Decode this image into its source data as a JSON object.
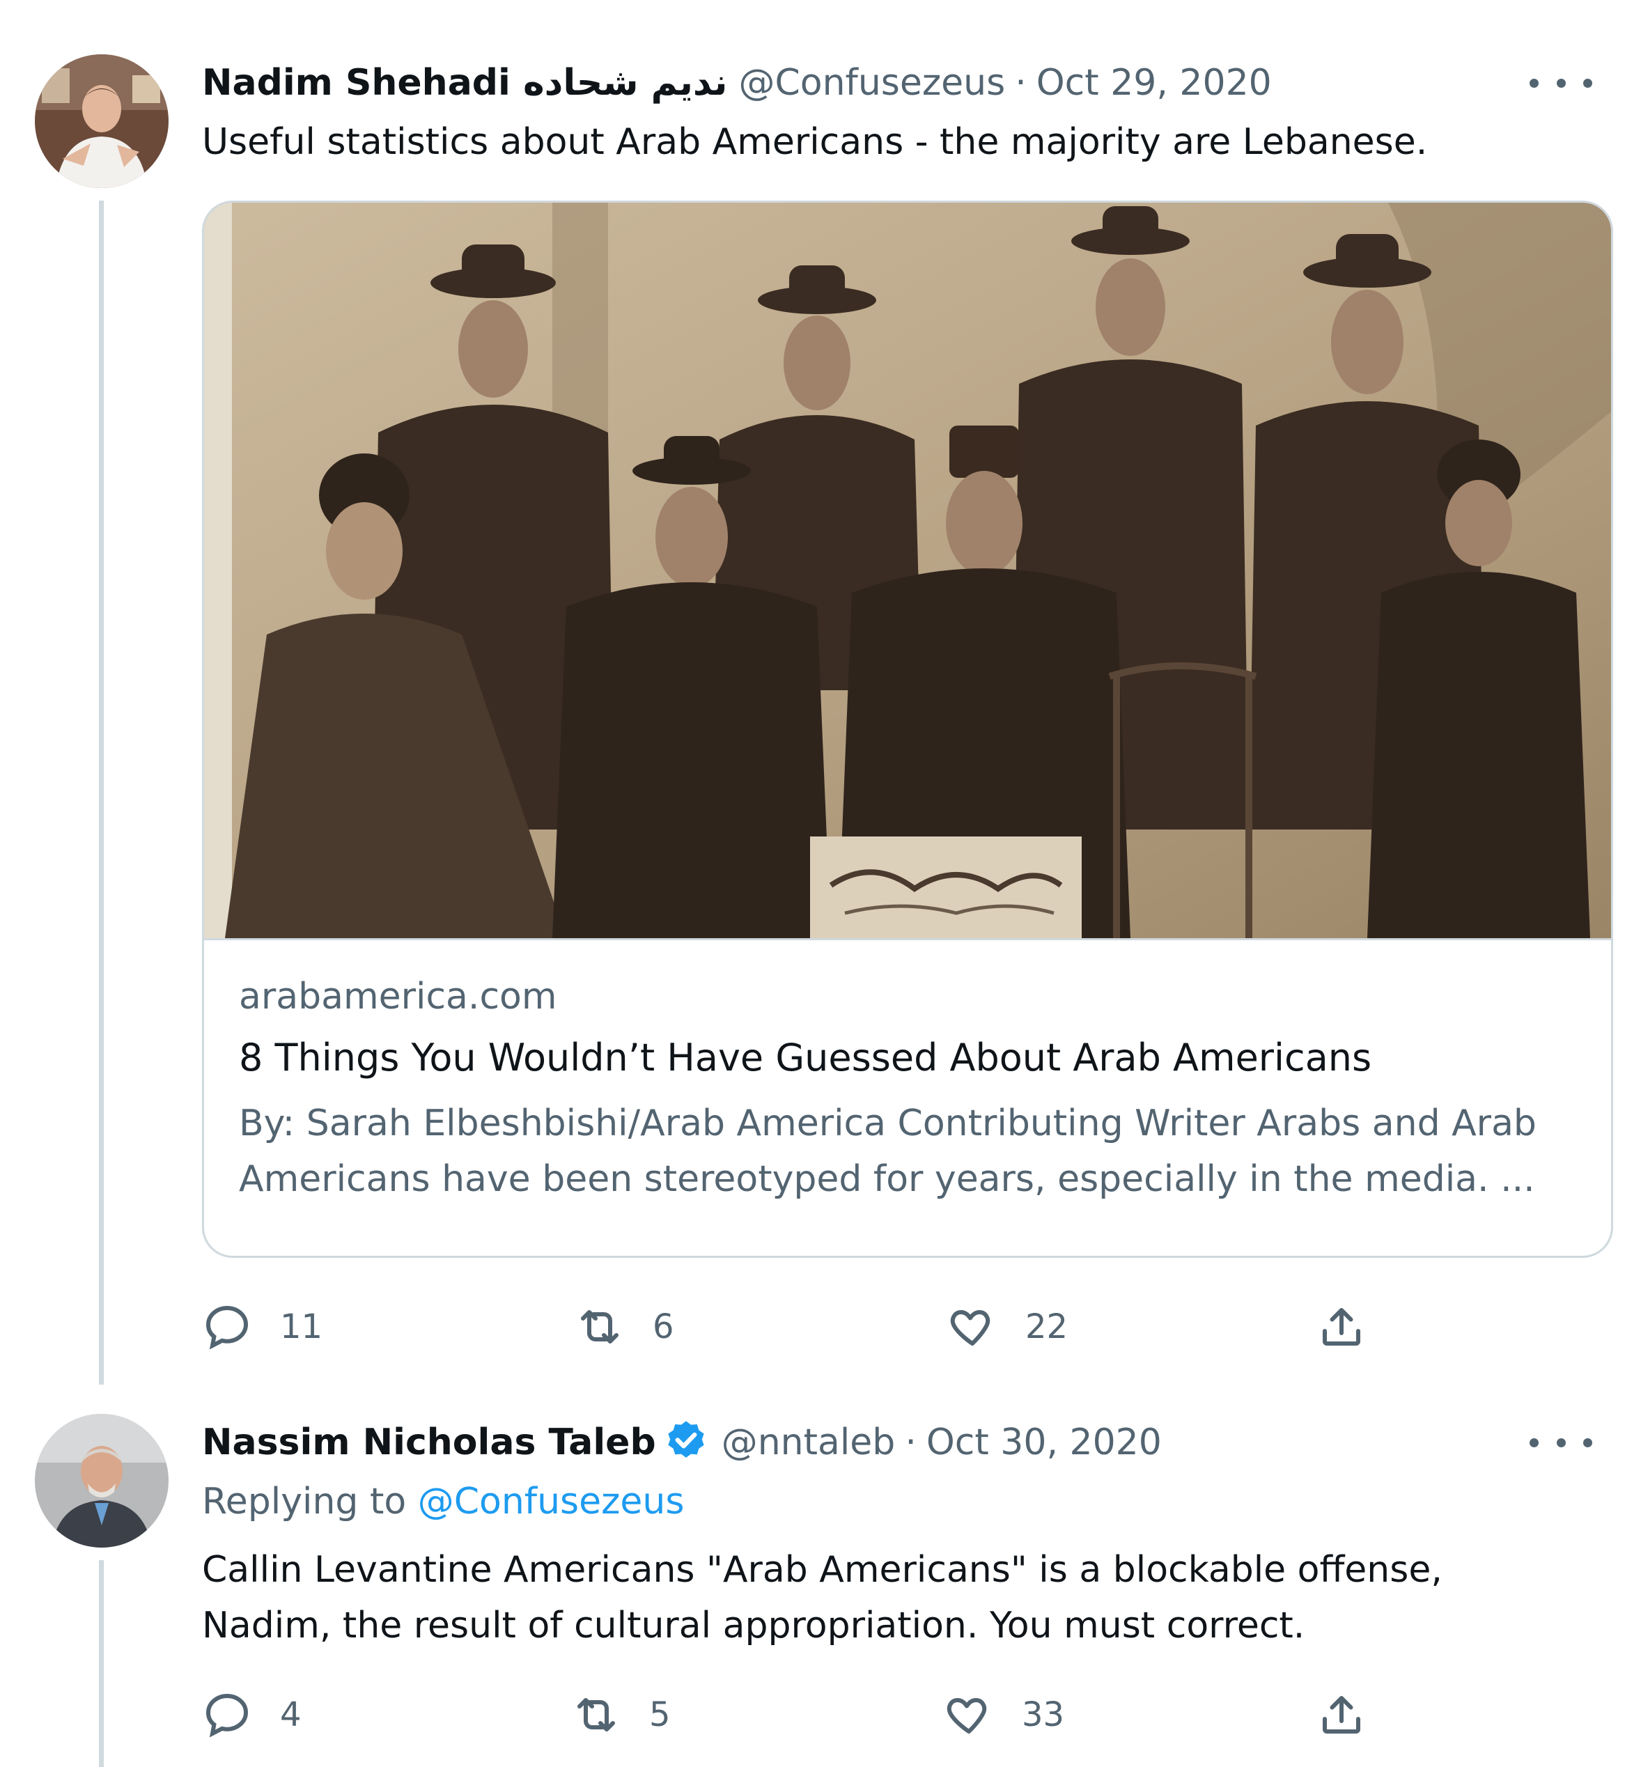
{
  "tweets": [
    {
      "author_name": "Nadim Shehadi نديم شحاده",
      "handle": "@Confusezeus",
      "separator": "·",
      "date": "Oct 29, 2020",
      "text": "Useful statistics about Arab Americans - the majority are Lebanese.",
      "card": {
        "domain": "arabamerica.com",
        "title": "8 Things You Wouldn’t Have Guessed About Arab Americans",
        "description": "By: Sarah Elbeshbishi/Arab America Contributing Writer Arabs and Arab Americans have been stereotyped for years, especially in the media. ..."
      },
      "actions": {
        "replies": "11",
        "retweets": "6",
        "likes": "22"
      }
    },
    {
      "author_name": "Nassim Nicholas Taleb",
      "verified": true,
      "handle": "@nntaleb",
      "separator": "·",
      "date": "Oct 30, 2020",
      "replying_label": "Replying to",
      "replying_handle": "@Confusezeus",
      "text_line1": "Callin Levantine Americans \"Arab Americans\" is a blockable offense,",
      "text_line2": "Nadim, the result of cultural appropriation. You must correct.",
      "actions": {
        "replies": "4",
        "retweets": "5",
        "likes": "33"
      }
    }
  ],
  "icons": {
    "reply": "speech-bubble-icon",
    "retweet": "retweet-arrows-icon",
    "like": "heart-icon",
    "share": "share-upload-icon",
    "more": "more-dots-icon",
    "verified": "verified-badge-icon"
  },
  "colors": {
    "text": "#0f1419",
    "secondary": "#536471",
    "link": "#1d9bf0",
    "border": "#cfd9de",
    "photo_tone": "#a8947a"
  }
}
